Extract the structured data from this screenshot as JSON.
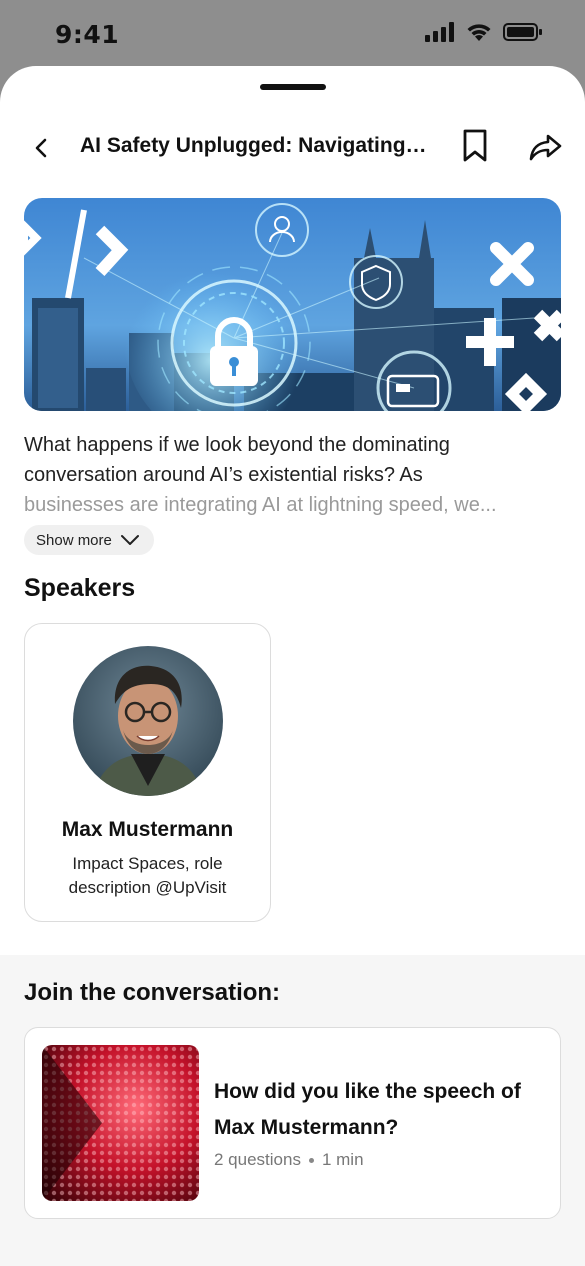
{
  "status_bar": {
    "time": "9:41",
    "icons": [
      "cellular-signal-icon",
      "wifi-icon",
      "battery-icon"
    ]
  },
  "nav": {
    "back_icon": "chevron-left-icon",
    "title": "AI Safety Unplugged: Navigating…",
    "bookmark_icon": "bookmark-icon",
    "share_icon": "share-arrow-icon"
  },
  "hero": {
    "image": "cybersecurity-city-skyline-illustration"
  },
  "description": {
    "line_visible": "What happens if we look beyond the dominating conversation around AI’s existential risks? As",
    "line_faded": "businesses are integrating AI at lightning speed, we...",
    "show_more_label": "Show more"
  },
  "speakers": {
    "title": "Speakers",
    "items": [
      {
        "name": "Max Mustermann",
        "role": "Impact Spaces, role description @UpVisit"
      }
    ]
  },
  "join": {
    "title": "Join the conversation:",
    "survey": {
      "question": "How did you like the speech of Max Mustermann?",
      "questions_count": "2 questions",
      "duration": "1 min"
    }
  },
  "colors": {
    "sheet_background": "#ffffff",
    "backdrop": "#8e8e8e",
    "section_background": "#f6f6f6",
    "hero_blue": "#3f8fd6"
  }
}
